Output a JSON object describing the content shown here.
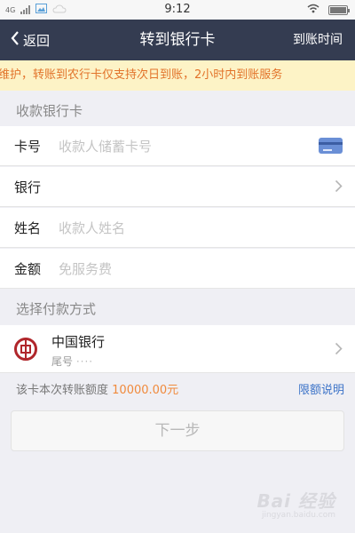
{
  "status_bar": {
    "network": "4G",
    "time": "9:12"
  },
  "nav": {
    "back_label": "返回",
    "title": "转到银行卡",
    "right_label": "到账时间"
  },
  "notice": {
    "text": "维护，转账到农行卡仅支持次日到账，2小时内到账服务"
  },
  "payee": {
    "section_label": "收款银行卡",
    "card_number": {
      "label": "卡号",
      "placeholder": "收款人储蓄卡号"
    },
    "bank": {
      "label": "银行",
      "value": ""
    },
    "name": {
      "label": "姓名",
      "placeholder": "收款人姓名"
    },
    "amount": {
      "label": "金额",
      "placeholder": "免服务费"
    }
  },
  "payment": {
    "section_label": "选择付款方式",
    "bank_name": "中国银行",
    "tail_label": "尾号",
    "tail_masked": "····"
  },
  "limit": {
    "text": "该卡本次转账额度",
    "amount": "10000.00元",
    "link_label": "限额说明"
  },
  "next_button": {
    "label": "下一步"
  },
  "watermark": {
    "text": "Bai 经验",
    "sub": "jingyan.baidu.com"
  },
  "colors": {
    "nav_bg": "#343c51",
    "notice_bg": "#fdf3c6",
    "notice_text": "#e2732a",
    "accent_link": "#3c73c8",
    "amount_text": "#f08a3c",
    "boc_red": "#b0262b"
  }
}
